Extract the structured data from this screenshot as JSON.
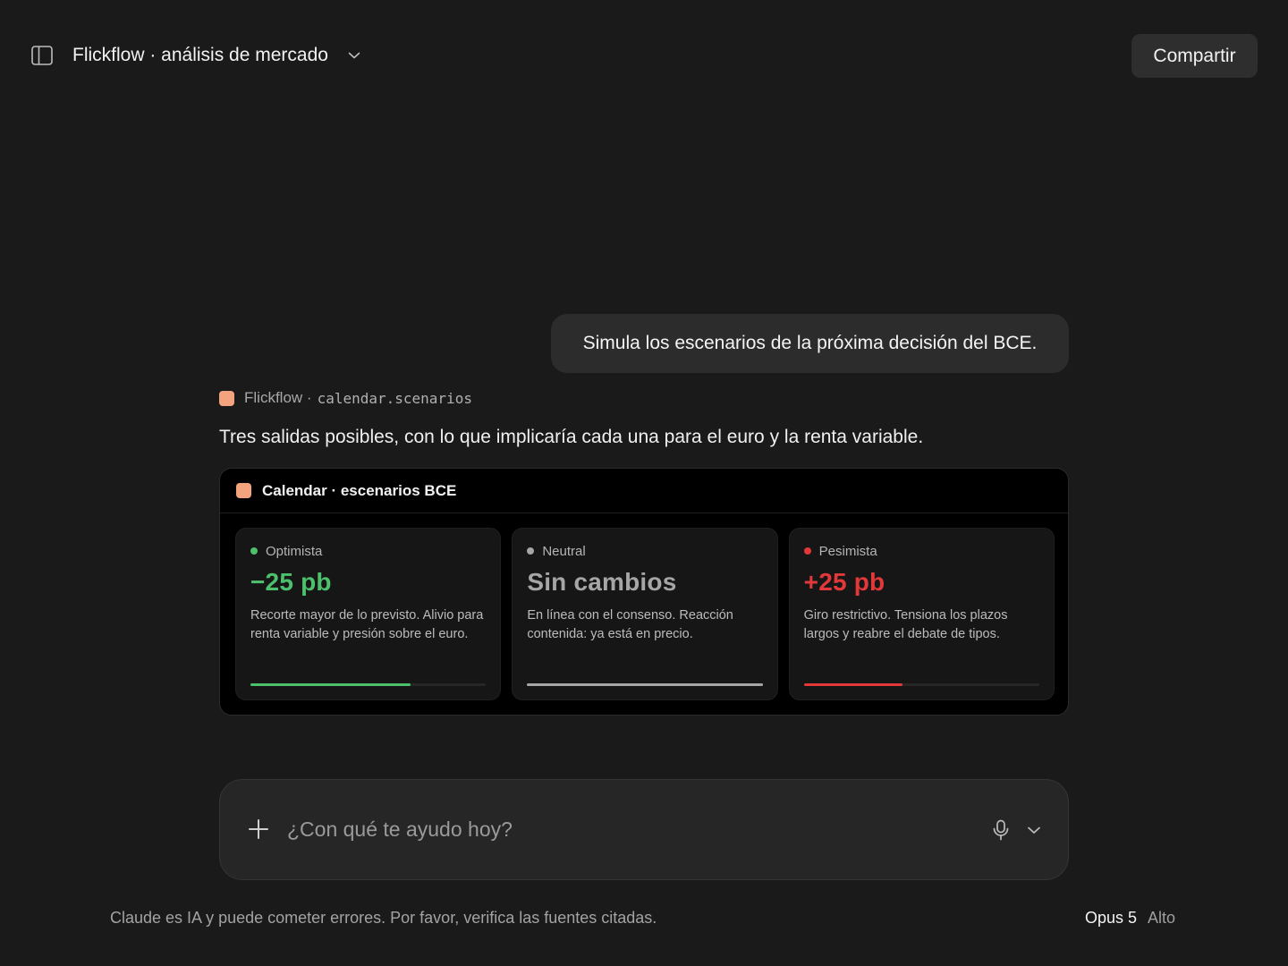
{
  "header": {
    "title": "Flickflow · análisis de mercado",
    "share_label": "Compartir"
  },
  "user_message": "Simula los escenarios de la próxima decisión del BCE.",
  "tool_call": {
    "app": "Flickflow ·",
    "function": "calendar.scenarios"
  },
  "assistant_text": "Tres salidas posibles, con lo que implicaría cada una para el euro y la renta variable.",
  "widget": {
    "title": "Calendar · escenarios BCE",
    "scenarios": [
      {
        "label": "Optimista",
        "value": "−25 pb",
        "description": "Recorte mayor de lo previsto. Alivio para renta variable y presión sobre el euro.",
        "color": "#4cc06b",
        "fill": 0.68
      },
      {
        "label": "Neutral",
        "value": "Sin cambios",
        "description": "En línea con el consenso. Reacción contenida: ya está en precio.",
        "color": "#a6a6a6",
        "fill": 1.0
      },
      {
        "label": "Pesimista",
        "value": "+25 pb",
        "description": "Giro restrictivo. Tensiona los plazos largos y reabre el debate de tipos.",
        "color": "#e2383a",
        "fill": 0.42
      }
    ]
  },
  "composer": {
    "placeholder": "¿Con qué te ayudo hoy?",
    "value": ""
  },
  "footer": {
    "disclaimer": "Claude es IA y puede cometer errores. Por favor, verifica las fuentes citadas.",
    "model": "Opus 5",
    "effort": "Alto"
  },
  "colors": {
    "background": "#1a1a1a",
    "accent": "#f3a37d"
  }
}
